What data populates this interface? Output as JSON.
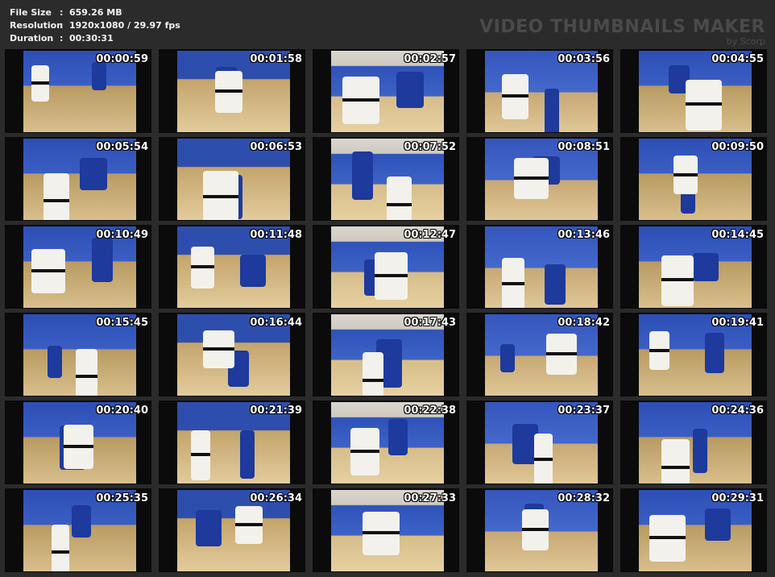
{
  "info": {
    "file_size_label": "File Size",
    "file_size": "659.26 MB",
    "resolution_label": "Resolution",
    "resolution": "1920x1080 / 29.97 fps",
    "duration_label": "Duration",
    "duration": "00:30:31",
    "separator": ":"
  },
  "brand": {
    "title": "VIDEO THUMBNAILS MAKER",
    "subtitle": "by Scorp"
  },
  "thumbnails": [
    {
      "time": "00:00:59"
    },
    {
      "time": "00:01:58"
    },
    {
      "time": "00:02:57"
    },
    {
      "time": "00:03:56"
    },
    {
      "time": "00:04:55"
    },
    {
      "time": "00:05:54"
    },
    {
      "time": "00:06:53"
    },
    {
      "time": "00:07:52"
    },
    {
      "time": "00:08:51"
    },
    {
      "time": "00:09:50"
    },
    {
      "time": "00:10:49"
    },
    {
      "time": "00:11:48"
    },
    {
      "time": "00:12:47"
    },
    {
      "time": "00:13:46"
    },
    {
      "time": "00:14:45"
    },
    {
      "time": "00:15:45"
    },
    {
      "time": "00:16:44"
    },
    {
      "time": "00:17:43"
    },
    {
      "time": "00:18:42"
    },
    {
      "time": "00:19:41"
    },
    {
      "time": "00:20:40"
    },
    {
      "time": "00:21:39"
    },
    {
      "time": "00:22:38"
    },
    {
      "time": "00:23:37"
    },
    {
      "time": "00:24:36"
    },
    {
      "time": "00:25:35"
    },
    {
      "time": "00:26:34"
    },
    {
      "time": "00:27:33"
    },
    {
      "time": "00:28:32"
    },
    {
      "time": "00:29:31"
    }
  ],
  "colors": {
    "background": "#2b2b2b",
    "mat_blue": "#2d4fb5",
    "floor": "#d9c08d",
    "gi_white": "#f3f1ec",
    "gi_blue": "#1d3a9c"
  }
}
